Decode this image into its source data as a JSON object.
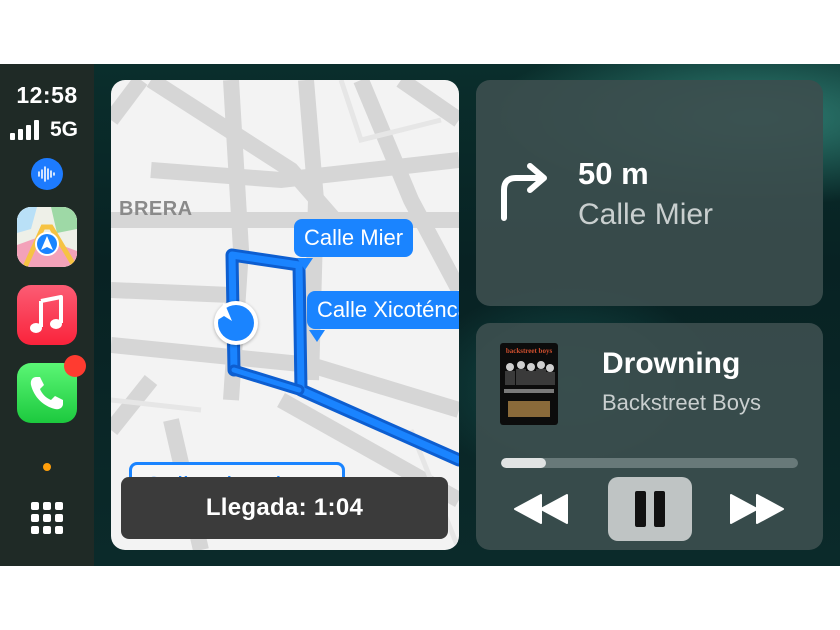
{
  "status": {
    "time": "12:58",
    "network": "5G",
    "signal_bars": 4
  },
  "dock": {
    "apps": [
      {
        "name": "Maps",
        "icon": "maps-icon"
      },
      {
        "name": "Music",
        "icon": "music-icon"
      },
      {
        "name": "Phone",
        "icon": "phone-icon",
        "has_badge": true
      }
    ],
    "siri_icon": "siri-icon",
    "app_grid_icon": "app-grid-icon"
  },
  "map": {
    "district_label": "BRERA",
    "street_bubbles": [
      "Calle Mier",
      "Calle Xicoténcatl"
    ],
    "street_label": "Calle Altamira",
    "arrival_text": "Llegada: 1:04",
    "route_color": "#1a84ff"
  },
  "navigation": {
    "turn_icon": "turn-right-icon",
    "distance": "50 m",
    "street": "Calle Mier"
  },
  "now_playing": {
    "song": "Drowning",
    "artist": "Backstreet Boys",
    "album_title_art": "backstreet boys",
    "progress": 0.15,
    "controls": [
      "rewind-icon",
      "pause-icon",
      "fast-forward-icon"
    ]
  },
  "colors": {
    "accent": "#1a84ff",
    "card": "#3c4e4e",
    "badge": "#ff3b30"
  }
}
